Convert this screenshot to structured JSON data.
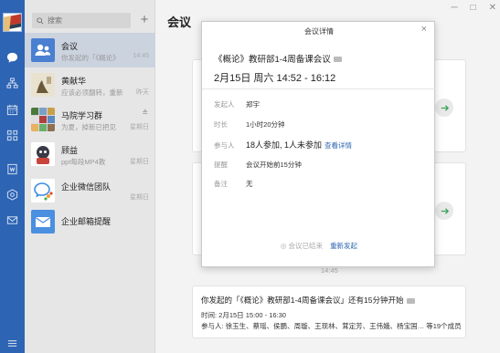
{
  "conversation_list": {
    "search_placeholder": "搜索",
    "add_label": "+",
    "items": [
      {
        "name": "会议",
        "preview": "你发起的「《概论》",
        "time": "14:45",
        "badge": ""
      },
      {
        "name": "黄献华",
        "preview": "应该必须翻转，重新",
        "time": "昨天",
        "badge": ""
      },
      {
        "name": "马院学习群",
        "preview": "为夏，掉新已把见",
        "time": "星期日",
        "badge": "≗"
      },
      {
        "name": "顾益",
        "preview": "ppt每段MP4教",
        "time": "星期日",
        "badge": ""
      },
      {
        "name": "企业微信团队",
        "preview": "",
        "time": "星期日",
        "badge": ""
      },
      {
        "name": "企业邮箱提醒",
        "preview": "",
        "time": "",
        "badge": ""
      }
    ]
  },
  "main": {
    "title": "会议",
    "timestamp": "14:45",
    "bottom_card": {
      "line1": "你发起的「《概论》教研部1-4周备课会议」还有15分钟开始",
      "line2": "时间: 2月15日 15:00 - 16:30",
      "line3": "参与人: 徐玉生、蔡瑶、侯鹏、周璇、王现林、茸定芳、王伟娥、杨宝国… 等19个成员"
    }
  },
  "modal": {
    "header": "会议详情",
    "close": "×",
    "meeting_title": "《概论》教研部1-4周备课会议",
    "datetime": "2月15日 周六 14:52 - 16:12",
    "rows": {
      "organizer_label": "发起人",
      "organizer": "郑宇",
      "duration_label": "时长",
      "duration": "1小时20分钟",
      "participants_label": "参与人",
      "participants": "18人参加, 1人未参加",
      "participants_link": "查看详情",
      "reminder_label": "提醒",
      "reminder": "会议开始前15分钟",
      "note_label": "备注",
      "note": "无"
    },
    "ended": "◎ 会议已结束",
    "relaunch": "重新发起"
  },
  "colors": {
    "accent": "#2d64b3",
    "green_arrow": "#3ba55d"
  },
  "icons": [
    "chat-icon",
    "contacts-icon",
    "calendar-icon",
    "apps-icon",
    "doc-icon",
    "workbench-icon",
    "mail-icon",
    "menu-icon"
  ]
}
